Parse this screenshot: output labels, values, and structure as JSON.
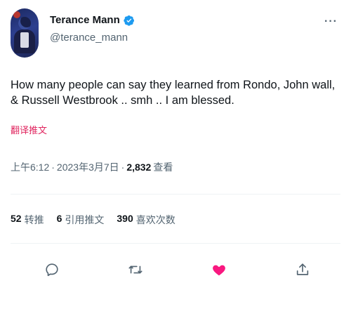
{
  "author": {
    "display_name": "Terance Mann",
    "handle": "@terance_mann",
    "verified": true
  },
  "tweet": {
    "text": "How many people can say they learned from Rondo, John wall, & Russell Westbrook .. smh .. I am blessed.",
    "translate_label": "翻译推文",
    "time": "上午6:12",
    "date": "2023年3月7日",
    "views_count": "2,832",
    "views_label": "查看"
  },
  "stats": {
    "retweets_count": "52",
    "retweets_label": "转推",
    "quotes_count": "6",
    "quotes_label": "引用推文",
    "likes_count": "390",
    "likes_label": "喜欢次数"
  },
  "colors": {
    "verified_blue": "#1d9bf0",
    "like_pink": "#f91880",
    "text_secondary": "#536471"
  },
  "icons": [
    "reply-icon",
    "retweet-icon",
    "like-icon",
    "share-icon",
    "more-icon",
    "verified-icon"
  ]
}
